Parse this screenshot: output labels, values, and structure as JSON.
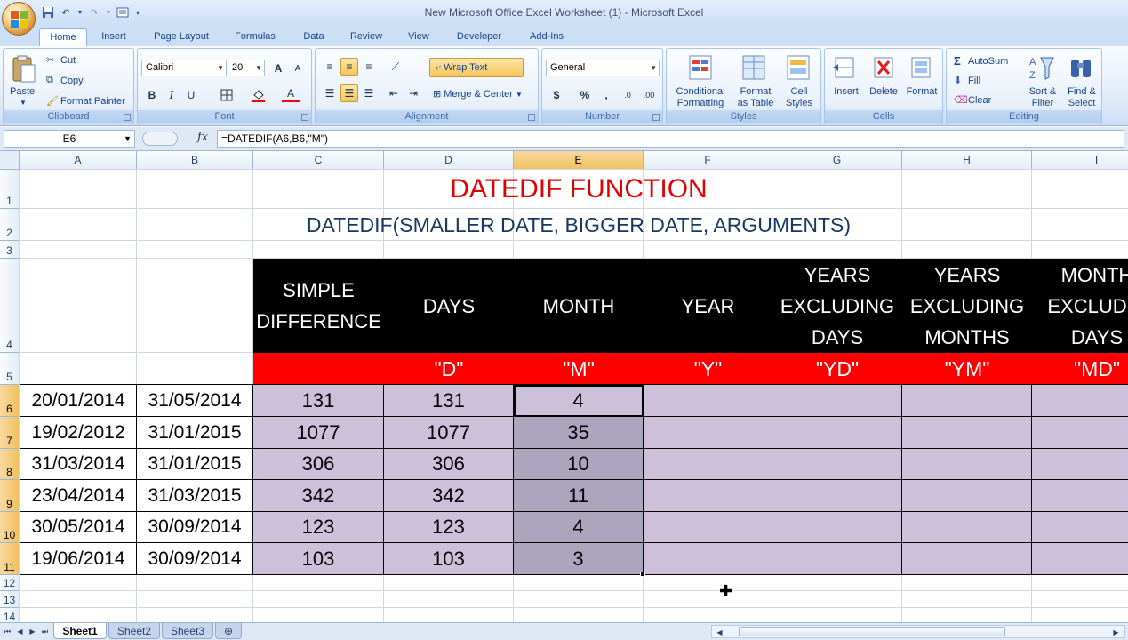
{
  "window": {
    "title": "New Microsoft Office Excel Worksheet (1) - Microsoft Excel"
  },
  "tabs": [
    "Home",
    "Insert",
    "Page Layout",
    "Formulas",
    "Data",
    "Review",
    "View",
    "Developer",
    "Add-Ins"
  ],
  "ribbon": {
    "clipboard": {
      "label": "Clipboard",
      "paste": "Paste",
      "cut": "Cut",
      "copy": "Copy",
      "format_painter": "Format Painter"
    },
    "font": {
      "label": "Font",
      "family": "Calibri",
      "size": "20",
      "bold": "B",
      "italic": "I",
      "underline": "U",
      "grow": "A",
      "shrink": "A",
      "font_color": "A"
    },
    "alignment": {
      "label": "Alignment",
      "wrap_text": "Wrap Text",
      "merge_center": "Merge & Center"
    },
    "number": {
      "label": "Number",
      "format": "General",
      "currency": "$",
      "percent": "%",
      "comma": ",",
      "inc_decimal": ".0",
      "dec_decimal": ".00"
    },
    "styles": {
      "label": "Styles",
      "conditional": "Conditional",
      "conditional2": "Formatting",
      "format_table": "Format",
      "format_table2": "as Table",
      "cell_styles": "Cell",
      "cell_styles2": "Styles"
    },
    "cells": {
      "label": "Cells",
      "insert": "Insert",
      "delete": "Delete",
      "format": "Format"
    },
    "editing": {
      "label": "Editing",
      "autosum": "AutoSum",
      "fill": "Fill",
      "clear": "Clear",
      "sort": "Sort &",
      "sort2": "Filter",
      "find": "Find &",
      "find2": "Select"
    }
  },
  "formula_bar": {
    "name_box": "E6",
    "fx": "fx",
    "formula": "=DATEDIF(A6,B6,\"M\")"
  },
  "columns": [
    "A",
    "B",
    "C",
    "D",
    "E",
    "F",
    "G",
    "H",
    "I"
  ],
  "rows": [
    "1",
    "2",
    "3",
    "4",
    "5",
    "6",
    "7",
    "8",
    "9",
    "10",
    "11",
    "12",
    "13",
    "14"
  ],
  "sheet": {
    "title": "DATEDIF FUNCTION",
    "subtitle": "DATEDIF(SMALLER DATE, BIGGER DATE, ARGUMENTS)",
    "headers": [
      {
        "lines": [
          "SIMPLE",
          "DIFFERENCE"
        ],
        "arg": ""
      },
      {
        "lines": [
          "DAYS"
        ],
        "arg": "\"D\""
      },
      {
        "lines": [
          "MONTH"
        ],
        "arg": "\"M\""
      },
      {
        "lines": [
          "YEAR"
        ],
        "arg": "\"Y\""
      },
      {
        "lines": [
          "YEARS",
          "EXCLUDING",
          "DAYS"
        ],
        "arg": "\"YD\""
      },
      {
        "lines": [
          "YEARS",
          "EXCLUDING",
          "MONTHS"
        ],
        "arg": "\"YM\""
      },
      {
        "lines": [
          "MONTH",
          "EXCLUDIN",
          "DAYS"
        ],
        "arg": "\"MD\""
      }
    ],
    "data": [
      [
        "20/01/2014",
        "31/05/2014",
        "131",
        "131",
        "4",
        "",
        "",
        "",
        ""
      ],
      [
        "19/02/2012",
        "31/01/2015",
        "1077",
        "1077",
        "35",
        "",
        "",
        "",
        ""
      ],
      [
        "31/03/2014",
        "31/01/2015",
        "306",
        "306",
        "10",
        "",
        "",
        "",
        ""
      ],
      [
        "23/04/2014",
        "31/03/2015",
        "342",
        "342",
        "11",
        "",
        "",
        "",
        ""
      ],
      [
        "30/05/2014",
        "30/09/2014",
        "123",
        "123",
        "4",
        "",
        "",
        "",
        ""
      ],
      [
        "19/06/2014",
        "30/09/2014",
        "103",
        "103",
        "3",
        "",
        "",
        "",
        ""
      ]
    ]
  },
  "sheet_tabs": [
    "Sheet1",
    "Sheet2",
    "Sheet3"
  ],
  "colors": {
    "title": "#e00000",
    "subtitle": "#17375e",
    "header_bg": "#000000",
    "arg_bg": "#ff0000",
    "data_bg": "#ccc0da"
  }
}
